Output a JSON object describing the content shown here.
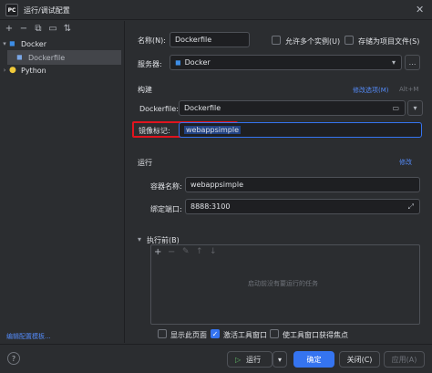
{
  "window": {
    "title": "运行/调试配置",
    "app_icon": "PC"
  },
  "tree": {
    "docker_label": "Docker",
    "dockerfile_label": "Dockerfile",
    "python_label": "Python"
  },
  "left_link": "编辑配置模板...",
  "form": {
    "name_label": "名称(N):",
    "name_value": "Dockerfile",
    "allow_parallel": "允许多个实例(U)",
    "store_as_project": "存储为项目文件(S)",
    "server_label": "服务器:",
    "server_value": "Docker",
    "build_heading": "构建",
    "modify_options": "修改选项(M)",
    "shortcut_hint": "Alt+M",
    "dockerfile_label": "Dockerfile:",
    "dockerfile_value": "Dockerfile",
    "image_tag_label": "镜像标记:",
    "image_tag_value": "webappsimple",
    "run_heading": "运行",
    "modify_link": "修改",
    "container_label": "容器名称:",
    "container_value": "webappsimple",
    "bind_ports_label": "绑定端口:",
    "bind_ports_value": "8888:3100",
    "before_launch": "执行前(B)",
    "empty_tasks": "启动前没有要运行的任务",
    "show_page": "显示此页面",
    "activate_tool": "激活工具窗口",
    "focus_tool": "使工具窗口获得焦点"
  },
  "footer": {
    "run": "运行",
    "ok": "确定",
    "cancel": "关闭(C)",
    "apply": "应用(A)",
    "help": "?"
  },
  "colors": {
    "accent": "#3574f0",
    "highlight": "#e0141e"
  }
}
